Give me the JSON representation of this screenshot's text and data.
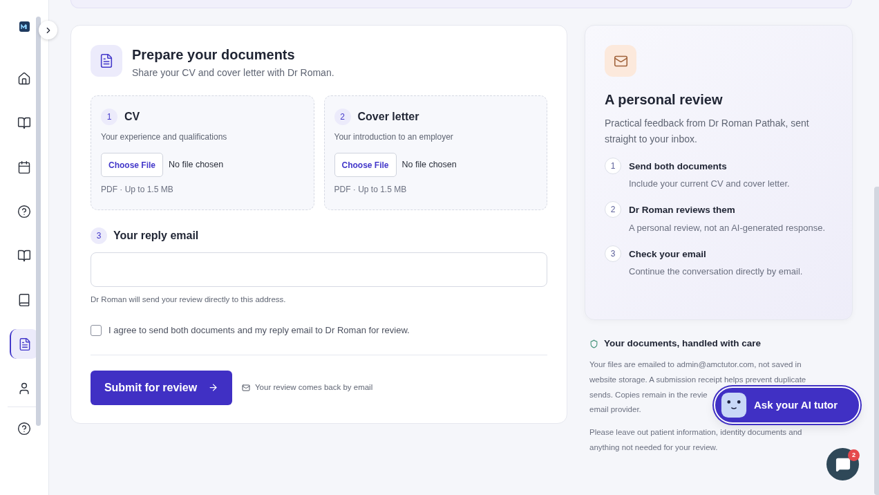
{
  "sidebar": {
    "items": [
      {
        "kind": "home",
        "selected": false
      },
      {
        "kind": "book-open",
        "selected": false
      },
      {
        "kind": "calendar",
        "selected": false
      },
      {
        "kind": "help",
        "selected": false
      },
      {
        "kind": "book-open",
        "selected": false
      },
      {
        "kind": "book",
        "selected": false
      },
      {
        "kind": "file",
        "selected": true
      },
      {
        "kind": "user",
        "selected": false
      }
    ],
    "footer_items": [
      {
        "kind": "help"
      }
    ]
  },
  "form": {
    "title": "Prepare your documents",
    "subtitle": "Share your CV and cover letter with Dr Roman.",
    "uploads": [
      {
        "number": "1",
        "title": "CV",
        "description": "Your experience and qualifications",
        "button": "Choose File",
        "status": "No file chosen",
        "hint": "PDF · Up to 1.5 MB"
      },
      {
        "number": "2",
        "title": "Cover letter",
        "description": "Your introduction to an employer",
        "button": "Choose File",
        "status": "No file chosen",
        "hint": "PDF · Up to 1.5 MB"
      }
    ],
    "email": {
      "number": "3",
      "label": "Your reply email",
      "help": "Dr Roman will send your review directly to this address."
    },
    "consent": {
      "label": "I agree to send both documents and my reply email to Dr Roman for review.",
      "checked": false
    },
    "submit": "Submit for review",
    "note": "Your review comes back by email"
  },
  "review": {
    "title": "A personal review",
    "intro": "Practical feedback from Dr Roman Pathak, sent straight to your inbox.",
    "steps": [
      {
        "number": "1",
        "title": "Send both documents",
        "text": "Include your current CV and cover letter."
      },
      {
        "number": "2",
        "title": "Dr Roman reviews them",
        "text": "A personal review, not an AI-generated response."
      },
      {
        "number": "3",
        "title": "Check your email",
        "text": "Continue the conversation directly by email."
      }
    ]
  },
  "privacy": {
    "title": "Your documents, handled with care",
    "paragraph_lines": [
      "Your files are emailed to admin@amctutor.com, not saved in",
      "website storage. A submission receipt helps prevent duplicate",
      "sends. Copies remain in the revie",
      "email provider."
    ],
    "note_lines": [
      "Please leave out patient information, identity documents and",
      "anything not needed for your review."
    ]
  },
  "tutor_button": "Ask your AI tutor",
  "chat": {
    "badge": "2"
  }
}
